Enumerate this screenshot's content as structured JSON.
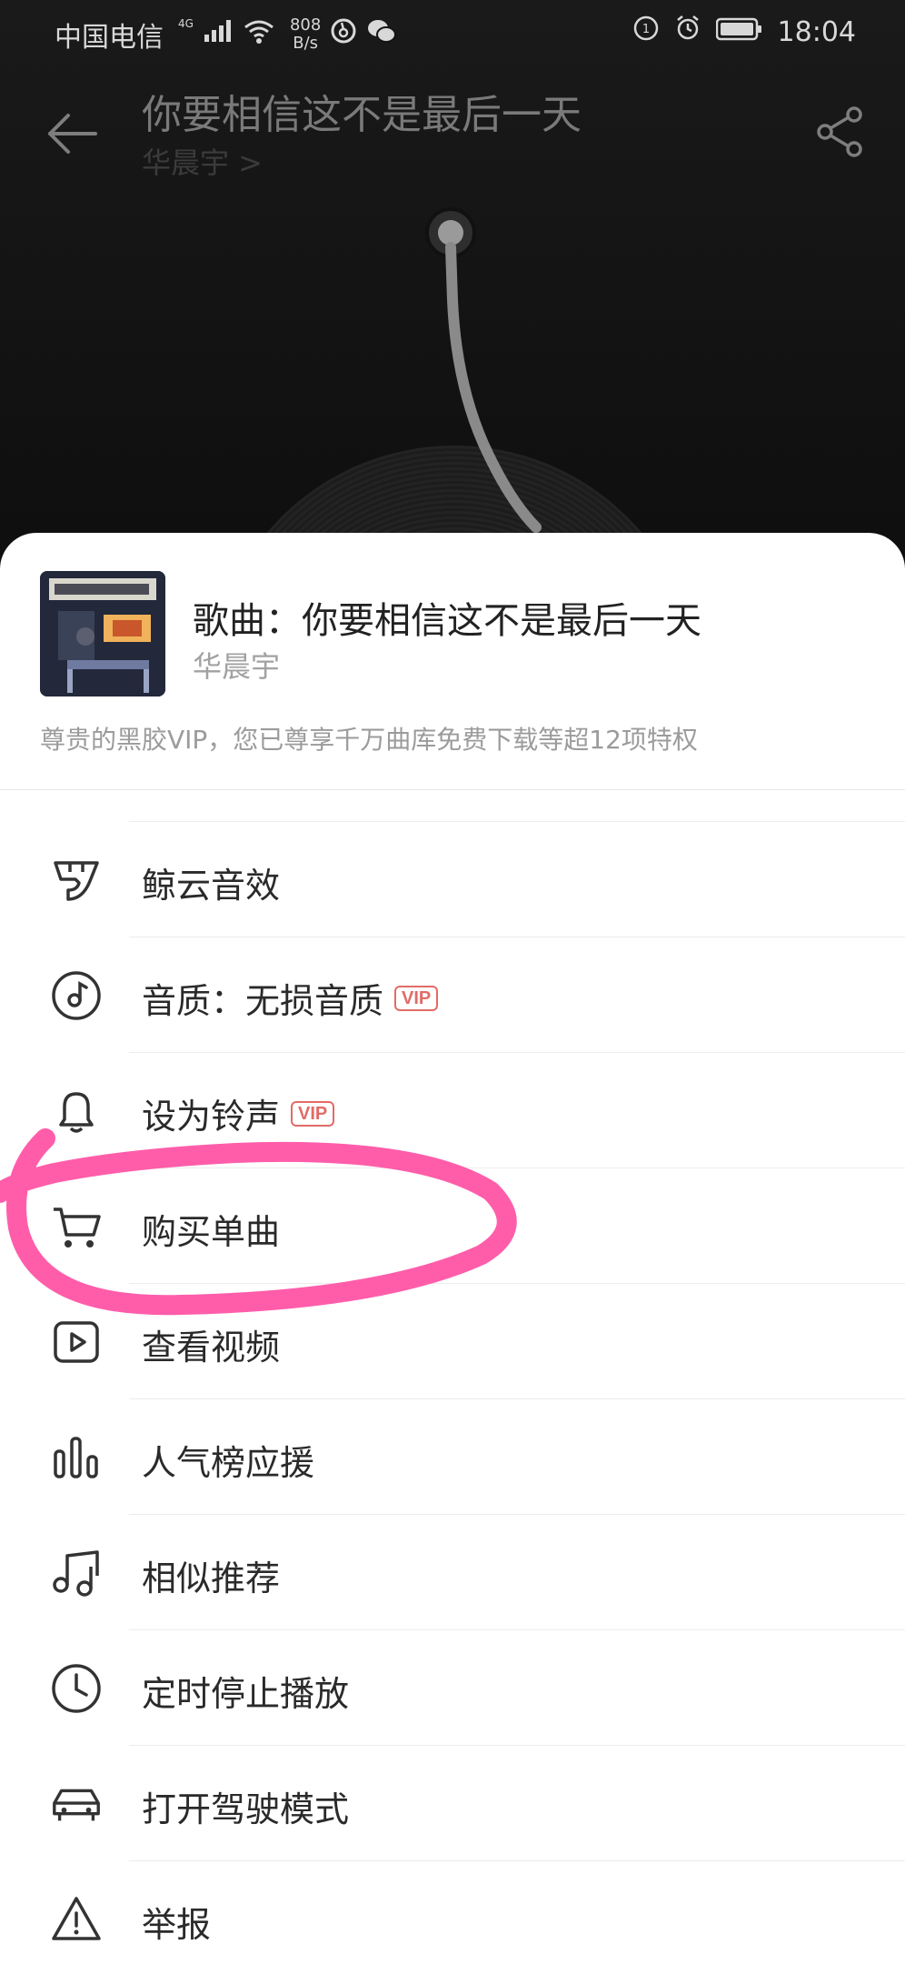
{
  "status_bar": {
    "carrier": "中国电信",
    "network": "4G",
    "speed_value": "808",
    "speed_unit": "B/s",
    "time": "18:04"
  },
  "player": {
    "song_title": "你要相信这不是最后一天",
    "artist": "华晨宇 >"
  },
  "sheet": {
    "title": "歌曲：你要相信这不是最后一天",
    "artist": "华晨宇",
    "vip_note": "尊贵的黑胶VIP，您已尊享千万曲库免费下载等超12项特权",
    "items": [
      {
        "label": "鲸云音效",
        "icon": "whale-icon",
        "vip": ""
      },
      {
        "label": "音质：无损音质",
        "icon": "music-disc-icon",
        "vip": "VIP"
      },
      {
        "label": "设为铃声",
        "icon": "bell-icon",
        "vip": "VIP"
      },
      {
        "label": "购买单曲",
        "icon": "cart-icon",
        "vip": ""
      },
      {
        "label": "查看视频",
        "icon": "video-icon",
        "vip": ""
      },
      {
        "label": "人气榜应援",
        "icon": "bar-chart-icon",
        "vip": ""
      },
      {
        "label": "相似推荐",
        "icon": "music-note-icon",
        "vip": ""
      },
      {
        "label": "定时停止播放",
        "icon": "clock-icon",
        "vip": ""
      },
      {
        "label": "打开驾驶模式",
        "icon": "car-icon",
        "vip": ""
      },
      {
        "label": "举报",
        "icon": "warning-icon",
        "vip": ""
      }
    ]
  },
  "colors": {
    "vip_badge": "#e26b67",
    "highlight": "#ff4fa3"
  }
}
